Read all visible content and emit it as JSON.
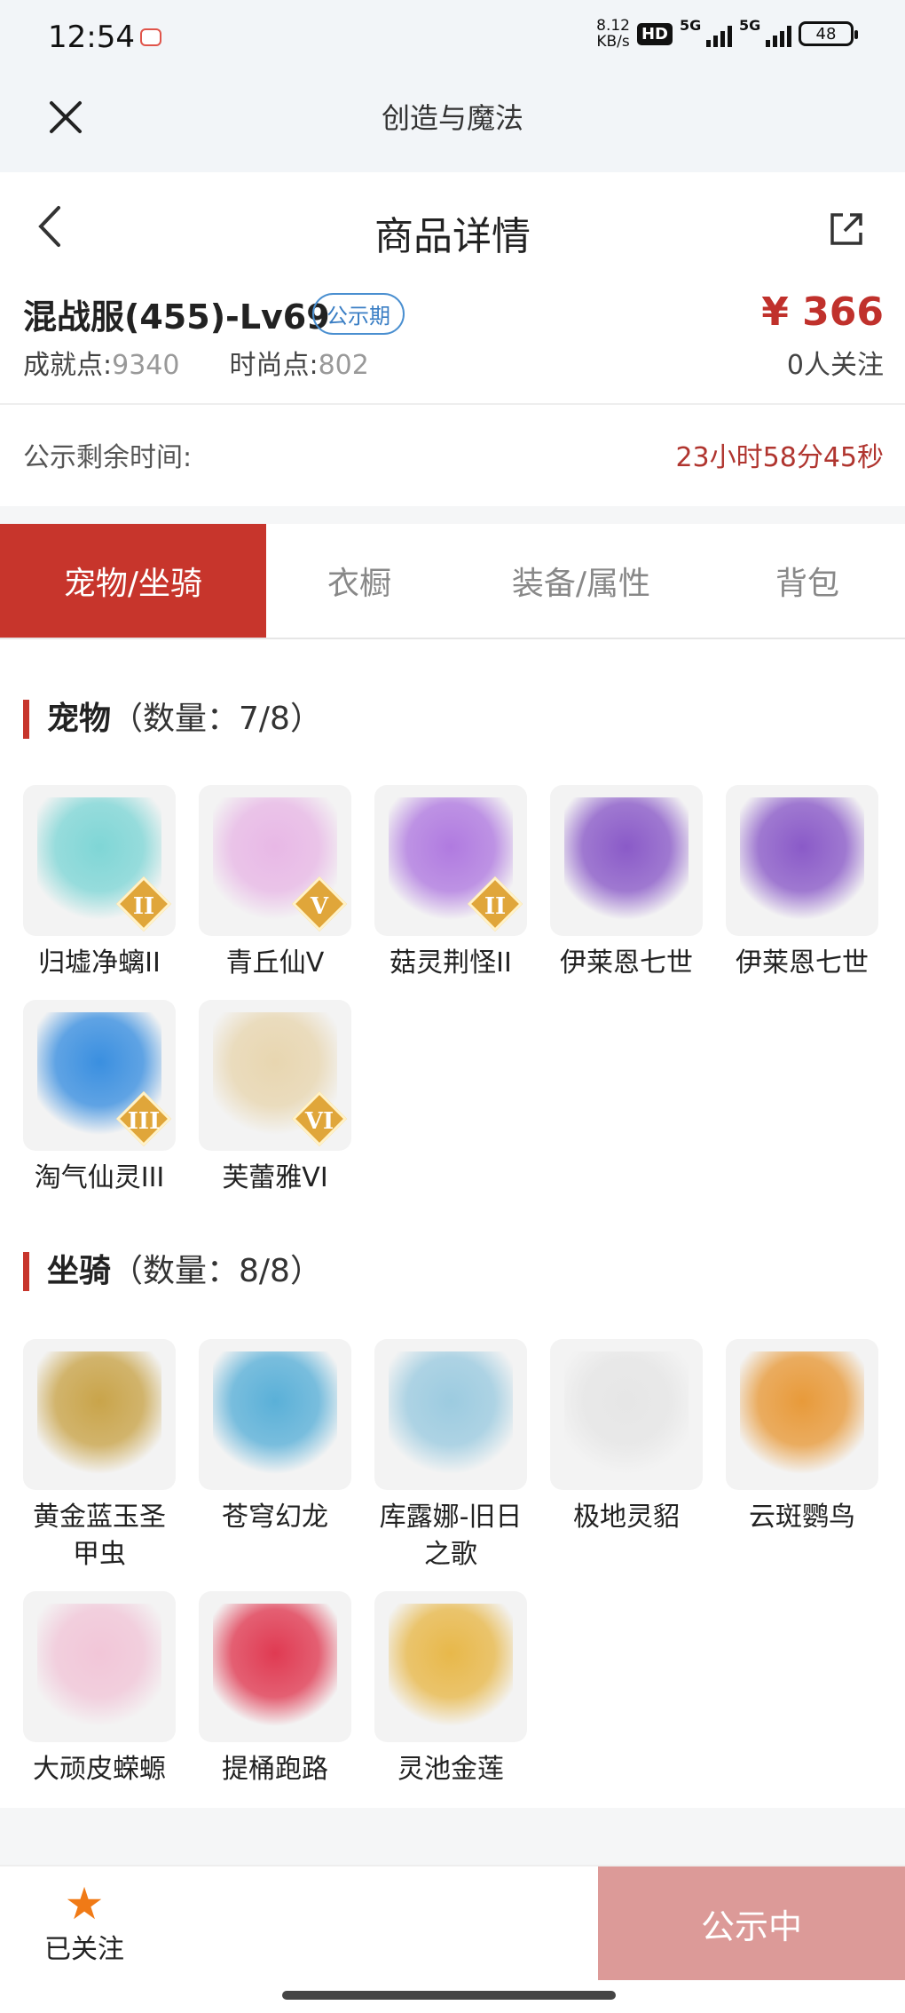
{
  "status_bar": {
    "time": "12:54",
    "net_speed_top": "8.12",
    "net_speed_bottom": "KB/s",
    "hd": "HD",
    "sig1": "5G",
    "sig2": "5G",
    "battery": "48"
  },
  "app_bar": {
    "title": "创造与魔法"
  },
  "header": {
    "title": "商品详情"
  },
  "item": {
    "server": "混战服(455)-Lv69",
    "badge": "公示期",
    "price": "¥ 366",
    "achievement_label": "成就点:",
    "achievement_value": "9340",
    "fashion_label": "时尚点:",
    "fashion_value": "802",
    "followers": "0人关注"
  },
  "countdown": {
    "label": "公示剩余时间:",
    "value": "23小时58分45秒"
  },
  "tabs": [
    "宠物/坐骑",
    "衣橱",
    "装备/属性",
    "背包"
  ],
  "pets": {
    "title": "宠物",
    "count": "（数量：7/8）",
    "items": [
      {
        "name": "归墟净螭II",
        "rank": "II",
        "color": "#7fd6d6"
      },
      {
        "name": "青丘仙V",
        "rank": "V",
        "color": "#e8b8e6"
      },
      {
        "name": "菇灵荆怪II",
        "rank": "II",
        "color": "#b07ae0"
      },
      {
        "name": "伊莱恩七世",
        "rank": "",
        "color": "#8a5ac8"
      },
      {
        "name": "伊莱恩七世",
        "rank": "",
        "color": "#8a5ac8"
      },
      {
        "name": "淘气仙灵III",
        "rank": "III",
        "color": "#3a8fe0"
      },
      {
        "name": "芙蕾雅VI",
        "rank": "VI",
        "color": "#e8d6b0"
      }
    ]
  },
  "mounts": {
    "title": "坐骑",
    "count": "（数量：8/8）",
    "items": [
      {
        "name": "黄金蓝玉圣甲虫",
        "color": "#c9a44a"
      },
      {
        "name": "苍穹幻龙",
        "color": "#5ab0d8"
      },
      {
        "name": "库露娜-旧日之歌",
        "color": "#9ccbe0"
      },
      {
        "name": "极地灵貂",
        "color": "#e6e6e6"
      },
      {
        "name": "云斑鹦鸟",
        "color": "#e89a3a"
      },
      {
        "name": "大顽皮蝾螈",
        "color": "#f2c6d8"
      },
      {
        "name": "提桶跑路",
        "color": "#e03a52"
      },
      {
        "name": "灵池金莲",
        "color": "#e8b84a"
      }
    ]
  },
  "bottom": {
    "follow_label": "已关注",
    "status_button": "公示中"
  }
}
